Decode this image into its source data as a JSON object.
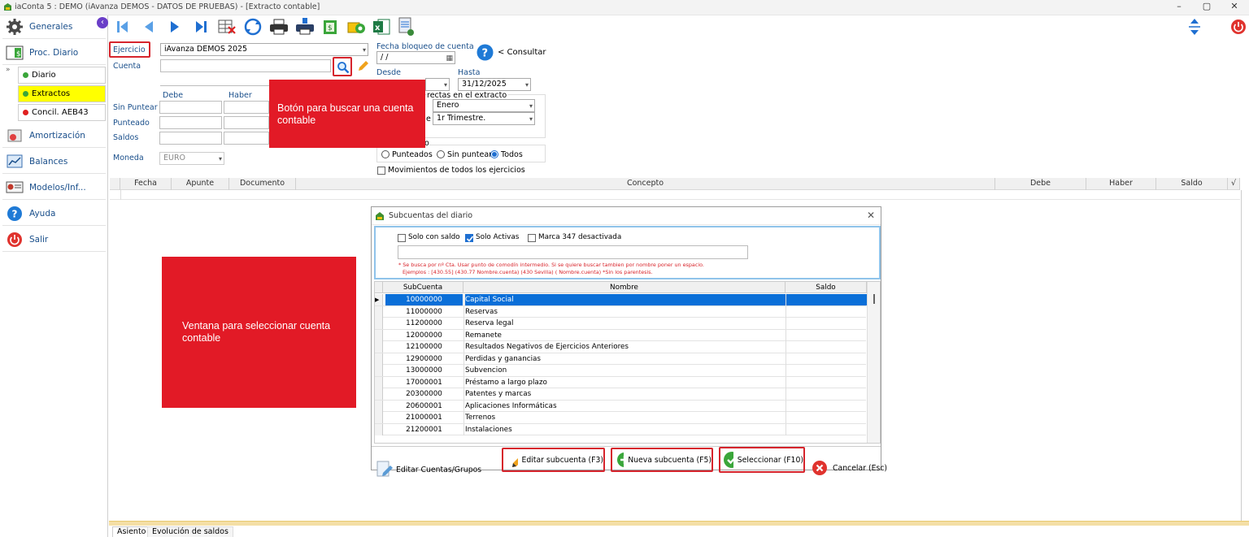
{
  "window": {
    "title": "iaConta 5 : DEMO (iAvanza DEMOS - DATOS DE PRUEBAS) - [Extracto contable]"
  },
  "sidebar": {
    "items": [
      {
        "label": "Generales",
        "icon": "gear-icon"
      },
      {
        "label": "Proc. Diario",
        "icon": "ledger-icon"
      },
      {
        "label": "Amortización",
        "icon": "amortization-icon"
      },
      {
        "label": "Balances",
        "icon": "chart-icon"
      },
      {
        "label": "Modelos/Inf...",
        "icon": "report-icon"
      },
      {
        "label": "Ayuda",
        "icon": "help-icon"
      },
      {
        "label": "Salir",
        "icon": "power-icon"
      }
    ],
    "subitems": [
      {
        "label": "Diario",
        "color": "#3aa63a"
      },
      {
        "label": "Extractos",
        "color": "#3aa63a"
      },
      {
        "label": "Concil. AEB43",
        "color": "#e02020"
      }
    ]
  },
  "form": {
    "ejercicio_label": "Ejercicio",
    "ejercicio_value": "iAvanza DEMOS 2025",
    "cuenta_label": "Cuenta",
    "debe_label": "Debe",
    "haber_label": "Haber",
    "sin_puntear_label": "Sin Puntear",
    "punteado_label": "Punteado",
    "saldos_label": "Saldos",
    "moneda_label": "Moneda",
    "moneda_value": "EURO",
    "fecha_bloqueo_label": "Fecha bloqueo de cuenta",
    "fecha_bloqueo_value": " /  /",
    "consultar_label": "< Consultar",
    "desde_label": "Desde",
    "hasta_label": "Hasta",
    "hasta_value": "31/12/2025",
    "fechas_label": "rectas en el extracto",
    "mes_value": "Enero",
    "trimestre_label": "e",
    "trimestre_value": "1r Trimestre.",
    "punteo_label": "o",
    "radio_punteados": "Punteados",
    "radio_sin_puntear": "Sin puntear",
    "radio_todos": "Todos",
    "movimientos_label": "Movimientos de todos los ejercicios"
  },
  "grid": {
    "headers": [
      "Fecha",
      "Apunte",
      "Documento",
      "Concepto",
      "Debe",
      "Haber",
      "Saldo",
      "√"
    ]
  },
  "callouts": {
    "search_button": "Botón para buscar una cuenta contable",
    "window": "Ventana para seleccionar cuenta contable"
  },
  "dialog": {
    "title": "Subcuentas del diario",
    "chk_solo_saldo": "Solo con saldo",
    "chk_solo_activas": "Solo Activas",
    "chk_marca_347": "Marca 347 desactivada",
    "hint1": "* Se busca por nº Cta. Usar punto de comodín intermedio. Si se quiere buscar tambien por nombre poner un espacio.",
    "hint2": "Ejemplos : [430.55] (430.77 Nombre.cuenta) (430 Sevilla)  (    Nombre.cuenta)  *Sin los parentesis.",
    "columns": [
      "SubCuenta",
      "Nombre",
      "Saldo"
    ],
    "rows": [
      {
        "code": "10000000",
        "name": "Capital Social"
      },
      {
        "code": "11000000",
        "name": "Reservas"
      },
      {
        "code": "11200000",
        "name": "Reserva legal"
      },
      {
        "code": "12000000",
        "name": "Remanete"
      },
      {
        "code": "12100000",
        "name": "Resultados Negativos de Ejercicios Anteriores"
      },
      {
        "code": "12900000",
        "name": "Perdidas y ganancias"
      },
      {
        "code": "13000000",
        "name": "Subvencion"
      },
      {
        "code": "17000001",
        "name": "Préstamo a largo plazo"
      },
      {
        "code": "20300000",
        "name": "Patentes y marcas"
      },
      {
        "code": "20600001",
        "name": "Aplicaciones Informáticas"
      },
      {
        "code": "21000001",
        "name": "Terrenos"
      },
      {
        "code": "21200001",
        "name": "Instalaciones"
      }
    ],
    "btn_editar_cuentas": "Editar Cuentas/Grupos",
    "btn_editar_subcuenta": "Editar subcuenta (F3)",
    "btn_nueva_subcuenta": "Nueva subcuenta (F5)",
    "btn_seleccionar": "Seleccionar (F10)",
    "btn_cancelar": "Cancelar (Esc)"
  },
  "tabs": [
    "Asiento",
    "Evolución de saldos"
  ]
}
